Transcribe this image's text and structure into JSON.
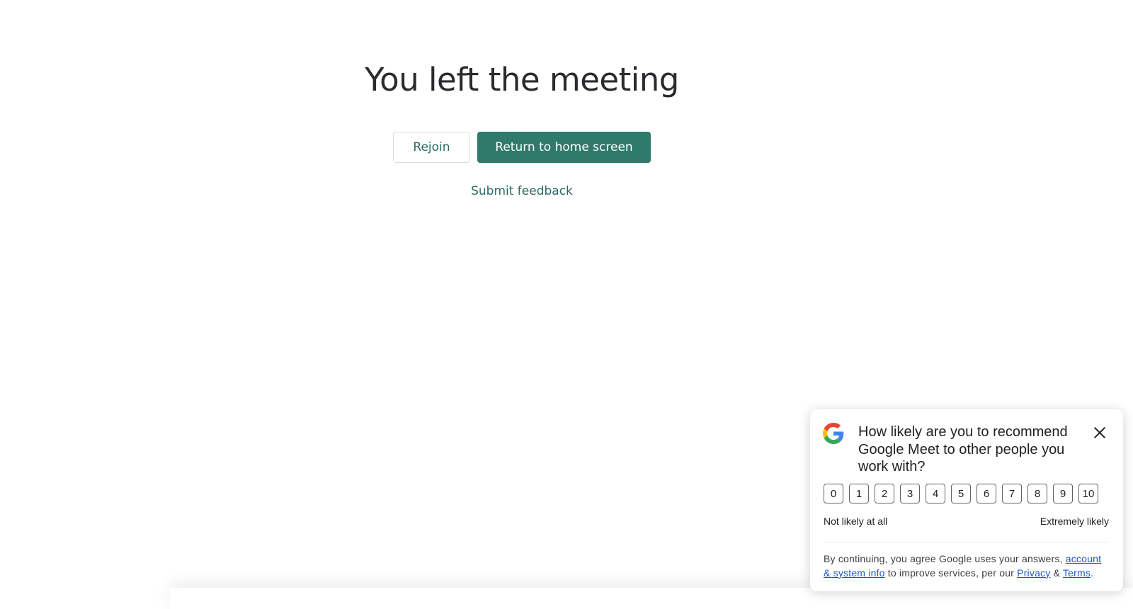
{
  "main": {
    "title": "You left the meeting",
    "rejoin_label": "Rejoin",
    "home_label": "Return to home screen",
    "feedback_label": "Submit feedback"
  },
  "survey": {
    "logo_icon": "google-g-icon",
    "question": "How likely are you to recommend Google Meet to other people you work with?",
    "close_icon": "close-icon",
    "scale": [
      "0",
      "1",
      "2",
      "3",
      "4",
      "5",
      "6",
      "7",
      "8",
      "9",
      "10"
    ],
    "label_low": "Not likely at all",
    "label_high": "Extremely likely",
    "legal": {
      "prefix": "By continuing, you agree Google uses your answers, ",
      "link1": "account & system info",
      "middle": " to improve services, per our ",
      "link2": "Privacy",
      "amp": " & ",
      "link3": "Terms",
      "suffix": "."
    }
  },
  "colors": {
    "accent": "#2f7a6b",
    "link": "#1a57c6"
  }
}
